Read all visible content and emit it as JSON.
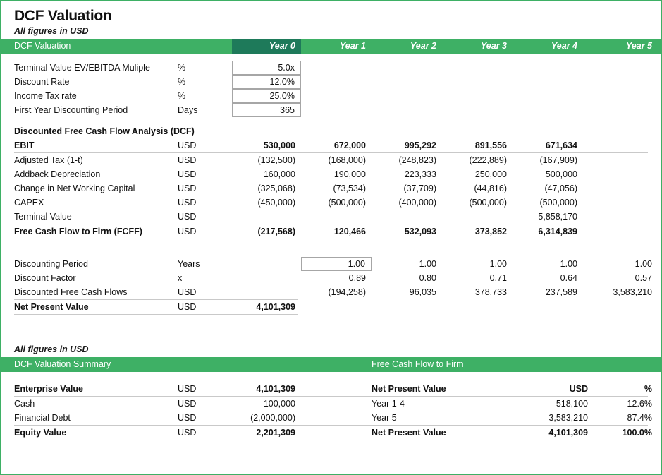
{
  "document": {
    "title": "DCF Valuation",
    "subtitle": "All figures in USD",
    "subtitle2": "All figures in USD"
  },
  "colors": {
    "band_green": "#3EB065",
    "year0_green": "#1E7A5A",
    "border_green": "#3EB065"
  },
  "columns": {
    "header_label": "DCF Valuation",
    "years": [
      "Year 0",
      "Year 1",
      "Year 2",
      "Year 3",
      "Year 4",
      "Year 5"
    ]
  },
  "assumptions": [
    {
      "label": "Terminal Value EV/EBITDA Muliple",
      "unit": "%",
      "value": "5.0x"
    },
    {
      "label": "Discount Rate",
      "unit": "%",
      "value": "12.0%"
    },
    {
      "label": "Income Tax rate",
      "unit": "%",
      "value": "25.0%"
    },
    {
      "label": "First Year Discounting Period",
      "unit": "Days",
      "value": "365"
    }
  ],
  "dcf": {
    "section_title": "Discounted Free Cash Flow Analysis (DCF)",
    "rows": [
      {
        "label": "EBIT",
        "unit": "USD",
        "values": [
          "530,000",
          "672,000",
          "995,292",
          "891,556",
          "671,634"
        ]
      },
      {
        "label": "Adjusted Tax (1-t)",
        "unit": "USD",
        "values": [
          "(132,500)",
          "(168,000)",
          "(248,823)",
          "(222,889)",
          "(167,909)"
        ]
      },
      {
        "label": "Addback Depreciation",
        "unit": "USD",
        "values": [
          "160,000",
          "190,000",
          "223,333",
          "250,000",
          "500,000"
        ]
      },
      {
        "label": "Change in Net Working Capital",
        "unit": "USD",
        "values": [
          "(325,068)",
          "(73,534)",
          "(37,709)",
          "(44,816)",
          "(47,056)"
        ]
      },
      {
        "label": "CAPEX",
        "unit": "USD",
        "values": [
          "(450,000)",
          "(500,000)",
          "(400,000)",
          "(500,000)",
          "(500,000)"
        ]
      },
      {
        "label": "Terminal Value",
        "unit": "USD",
        "values": [
          "",
          "",
          "",
          "",
          "5,858,170"
        ]
      },
      {
        "label": "Free Cash Flow to Firm (FCFF)",
        "unit": "USD",
        "values": [
          "(217,568)",
          "120,466",
          "532,093",
          "373,852",
          "6,314,839"
        ]
      }
    ]
  },
  "discounting": {
    "rows": [
      {
        "label": "Discounting Period",
        "unit": "Years",
        "values": [
          "1.00",
          "1.00",
          "1.00",
          "1.00",
          "1.00"
        ]
      },
      {
        "label": "Discount Factor",
        "unit": "x",
        "values": [
          "0.89",
          "0.80",
          "0.71",
          "0.64",
          "0.57"
        ]
      },
      {
        "label": "Discounted Free Cash Flows",
        "unit": "USD",
        "values": [
          "(194,258)",
          "96,035",
          "378,733",
          "237,589",
          "3,583,210"
        ]
      }
    ],
    "npv": {
      "label": "Net Present Value",
      "unit": "USD",
      "value": "4,101,309"
    }
  },
  "summary_left": {
    "band_title": "DCF Valuation Summary",
    "rows": [
      {
        "label": "Enterprise Value",
        "unit": "USD",
        "value": "4,101,309",
        "bold": true
      },
      {
        "label": "Cash",
        "unit": "USD",
        "value": "100,000",
        "bold": false
      },
      {
        "label": "Financial Debt",
        "unit": "USD",
        "value": "(2,000,000)",
        "bold": false
      },
      {
        "label": "Equity Value",
        "unit": "USD",
        "value": "2,201,309",
        "bold": true
      }
    ]
  },
  "summary_right": {
    "band_title": "Free Cash Flow to Firm",
    "header": {
      "label": "Net Present Value",
      "unit": "USD",
      "pct": "%"
    },
    "rows": [
      {
        "label": "Year 1-4",
        "value": "518,100",
        "pct": "12.6%"
      },
      {
        "label": "Year 5",
        "value": "3,583,210",
        "pct": "87.4%"
      }
    ],
    "total": {
      "label": "Net Present Value",
      "value": "4,101,309",
      "pct": "100.0%"
    }
  }
}
